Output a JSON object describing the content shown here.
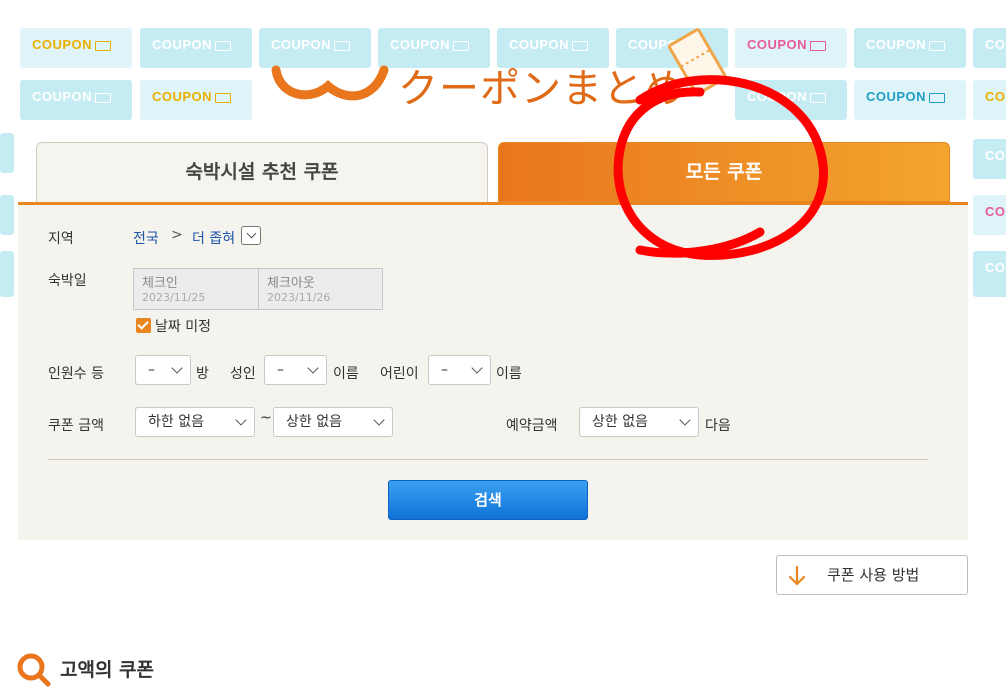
{
  "background": {
    "tile_text": "COUPON"
  },
  "logo": {
    "text": "クーポンまとめ"
  },
  "tabs": [
    {
      "label": "숙박시설 추천 쿠폰",
      "active": false
    },
    {
      "label": "모든 쿠폰",
      "active": true
    }
  ],
  "form": {
    "region": {
      "label": "지역",
      "value": "전국",
      "separator": ">",
      "more": "더 좁혀"
    },
    "stay_date": {
      "label": "숙박일",
      "checkin": {
        "title": "체크인",
        "value": "2023/11/25"
      },
      "checkout": {
        "title": "체크아웃",
        "value": "2023/11/26"
      },
      "undecided": {
        "label": "날짜 미정",
        "checked": true
      }
    },
    "guests": {
      "label": "인원수 등",
      "rooms": {
        "value": "–",
        "unit": "방"
      },
      "adults": {
        "label": "성인",
        "value": "–",
        "unit": "이름"
      },
      "children": {
        "label": "어린이",
        "value": "–",
        "unit": "이름"
      }
    },
    "coupon_amount": {
      "label": "쿠폰 금액",
      "min": "하한 없음",
      "tilde": "~",
      "max": "상한 없음"
    },
    "booking_amount": {
      "label": "예약금액",
      "value": "상한 없음",
      "suffix": "다음"
    },
    "search_label": "검색"
  },
  "howto_label": "쿠폰 사용 방법",
  "section": {
    "title": "고액의 쿠폰"
  },
  "colors": {
    "accent": "#e9861f",
    "link": "#1d55a8",
    "button": "#1a7fe0",
    "annotation": "#ff0000"
  },
  "icons": [
    "down-arrow-icon",
    "search-icon",
    "chevron-down-icon",
    "ticket-icon",
    "checkbox-icon"
  ]
}
